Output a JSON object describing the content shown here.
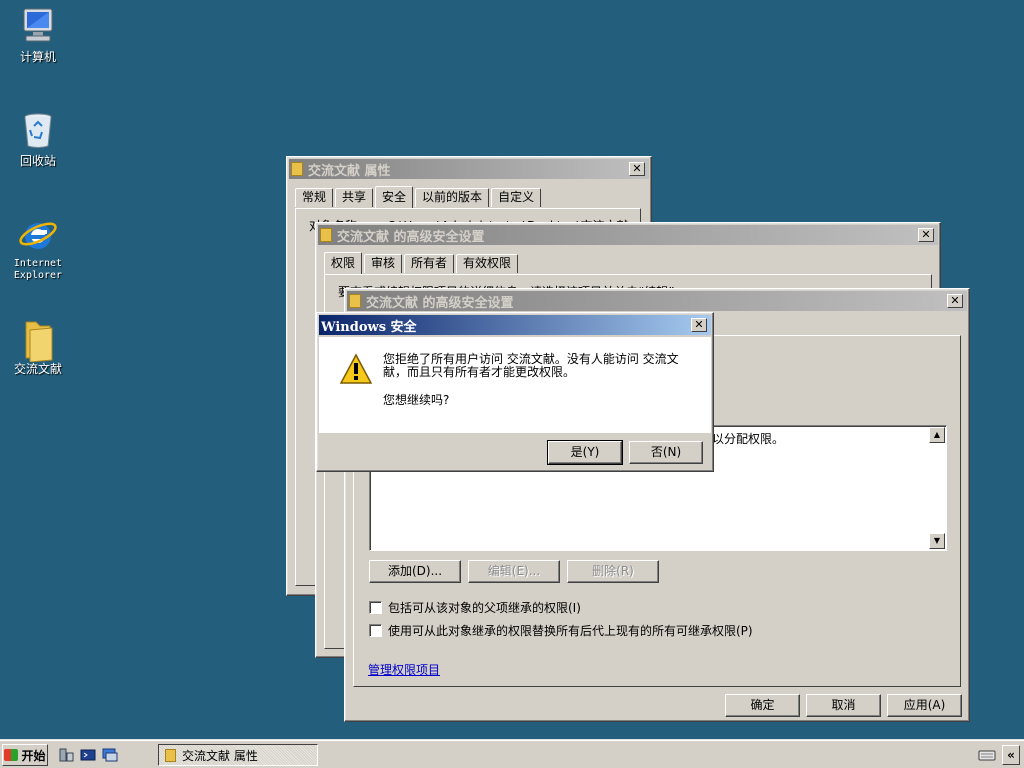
{
  "desktop": {
    "icons": [
      {
        "label": "计算机"
      },
      {
        "label": "回收站"
      },
      {
        "label": "Internet Explorer"
      },
      {
        "label": "交流文献"
      }
    ]
  },
  "properties_window": {
    "title": "交流文献 属性",
    "tabs": [
      "常规",
      "共享",
      "安全",
      "以前的版本",
      "自定义"
    ],
    "active_tab": "安全",
    "object_name_label": "对象名称:",
    "object_name_value": "C:\\Users\\Administrator\\Desktop\\交流文献"
  },
  "adv_window_1": {
    "title": "交流文献 的高级安全设置",
    "tabs": [
      "权限",
      "审核",
      "所有者",
      "有效权限"
    ],
    "active_tab": "权限",
    "instruction": "要查看或编辑权限项目的详细信息，请选择该项目并单击“编辑”。"
  },
  "adv_window_2": {
    "title": "交流文献 的高级安全设置",
    "list_text": "没有组或用户具有访问此对象的权限。但是，此对象的所有者可以分配权限。",
    "add_button": "添加(D)...",
    "edit_button": "编辑(E)...",
    "delete_button": "删除(R)",
    "checkbox_inherit": "包括可从该对象的父项继承的权限(I)",
    "checkbox_replace": "使用可从此对象继承的权限替换所有后代上现有的所有可继承权限(P)",
    "manage_link": "管理权限项目",
    "ok_button": "确定",
    "cancel_button": "取消",
    "apply_button": "应用(A)"
  },
  "security_dialog": {
    "title": "Windows 安全",
    "message": "您拒绝了所有用户访问 交流文献。没有人能访问 交流文献，而且只有所有者才能更改权限。",
    "question": "您想继续吗?",
    "yes_button": "是(Y)",
    "no_button": "否(N)"
  },
  "taskbar": {
    "start_label": "开始",
    "task_item_label": "交流文献 属性",
    "tray_expand": "«"
  },
  "colors": {
    "desktop": "#235f7d",
    "active_title_start": "#0a246a",
    "active_title_end": "#a6caf0",
    "window_face": "#d4d0c8"
  }
}
